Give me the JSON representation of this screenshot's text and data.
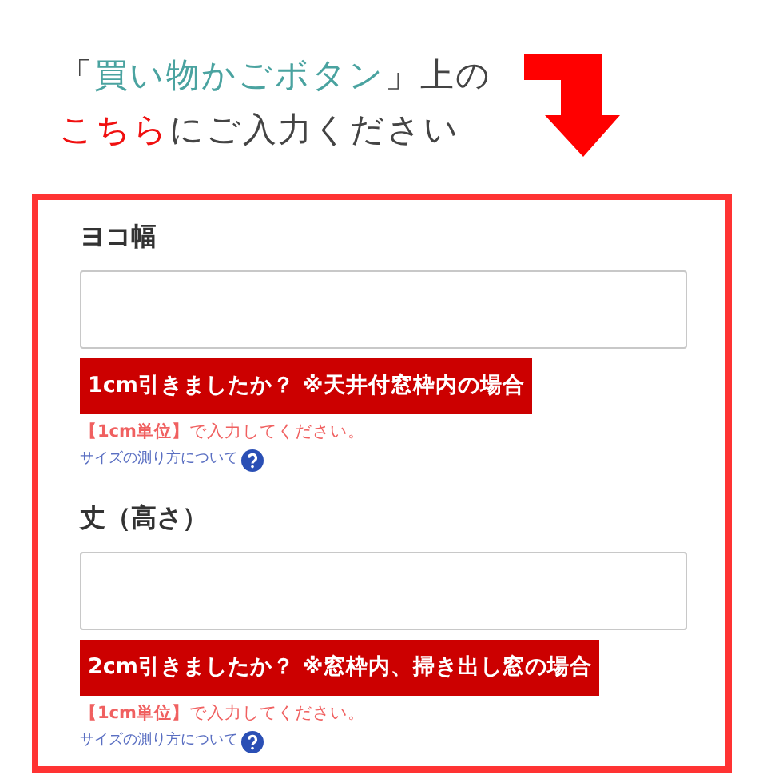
{
  "heading": {
    "lines": [
      [
        {
          "text": "「",
          "kind": "plain"
        },
        {
          "text": "買い物かごボタン",
          "kind": "teal"
        },
        {
          "text": "」上の",
          "kind": "plain"
        }
      ],
      [
        {
          "text": "こちら",
          "kind": "red"
        },
        {
          "text": "にご入力ください",
          "kind": "plain"
        }
      ]
    ]
  },
  "fields": [
    {
      "label": "ヨコ幅",
      "notice": "1cm引きましたか？ ※天井付窓枠内の場合",
      "hint": "**【1cm単位】**で入力してください。",
      "link": "サイズの測り方について"
    },
    {
      "label": "丈（高さ）",
      "notice": "2cm引きましたか？ ※窓枠内、掃き出し窓の場合",
      "hint": "**【1cm単位】**で入力してください。",
      "link": "サイズの測り方について"
    }
  ]
}
